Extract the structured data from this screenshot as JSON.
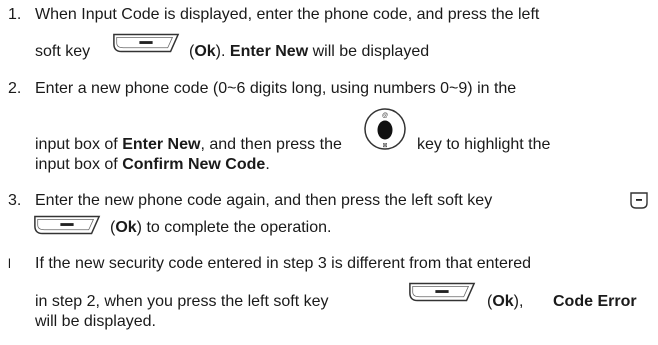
{
  "steps": [
    {
      "number": "1.",
      "lines": [
        {
          "t1": "When Input Code is displayed, enter the phone code, and press the left"
        },
        {
          "t1": "soft key",
          "ok_open": "(",
          "ok": "Ok",
          "ok_close": ").",
          "bold": "Enter New",
          "t2": "will be displayed"
        }
      ]
    },
    {
      "number": "2.",
      "lines": [
        {
          "t1": "Enter a new phone code (0~6 digits long, using numbers 0~9) in the"
        },
        {
          "t1": "input box of",
          "bold": "Enter New",
          "t2": ", and then press the",
          "t3": "key to highlight the"
        },
        {
          "t1": "input box of",
          "bold": "Confirm New Code",
          "t2": "."
        }
      ]
    },
    {
      "number": "3.",
      "lines": [
        {
          "t1": "Enter the new phone code again, and then press the left soft key"
        },
        {
          "ok_open": "(",
          "ok": "Ok",
          "ok_close": ")",
          "t1": "to complete the operation."
        }
      ]
    }
  ],
  "note": {
    "bullet": "l",
    "lines": [
      {
        "t1": "If the new security code entered in step 3 is different from that entered"
      },
      {
        "t1": "in step 2, when you press the left soft key",
        "ok_open": "(",
        "ok": "Ok",
        "ok_close": "),",
        "bold": "Code Error"
      },
      {
        "t1": "will be displayed."
      }
    ]
  },
  "icons": [
    "left-soft-key-icon",
    "navigation-key-icon",
    "end-key-icon"
  ]
}
